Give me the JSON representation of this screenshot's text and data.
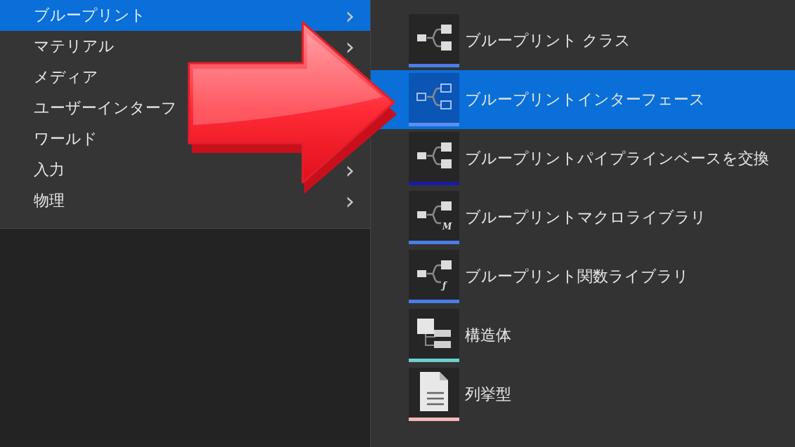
{
  "main_menu": [
    {
      "label": "ブループリント",
      "selected": true,
      "chevron": "›"
    },
    {
      "label": "マテリアル",
      "selected": false,
      "chevron": "›"
    },
    {
      "label": "メディア",
      "selected": false
    },
    {
      "label": "ユーザーインターフ",
      "selected": false
    },
    {
      "label": "ワールド",
      "selected": false
    },
    {
      "label": "入力",
      "selected": false,
      "chevron": "›"
    },
    {
      "label": "物理",
      "selected": false,
      "chevron": "›"
    }
  ],
  "submenu": [
    {
      "label": "ブループリント クラス",
      "kind": "graph",
      "selected": false,
      "color": "#4a7de8"
    },
    {
      "label": "ブループリントインターフェース",
      "kind": "interface",
      "selected": true,
      "color": "#5b8ff0"
    },
    {
      "label": "ブループリントパイプラインベースを交換",
      "kind": "graph",
      "selected": false,
      "color": "#1a1aa8"
    },
    {
      "label": "ブループリントマクロライブラリ",
      "kind": "library",
      "glyph": "M",
      "selected": false,
      "color": "#4a7de8"
    },
    {
      "label": "ブループリント関数ライブラリ",
      "kind": "library",
      "glyph": "ƒ",
      "selected": false,
      "color": "#4a7de8"
    },
    {
      "label": "構造体",
      "kind": "struct",
      "selected": false,
      "color": "#6ccfcf"
    },
    {
      "label": "列挙型",
      "kind": "enum",
      "selected": false,
      "color": "#f4b8bc"
    }
  ]
}
